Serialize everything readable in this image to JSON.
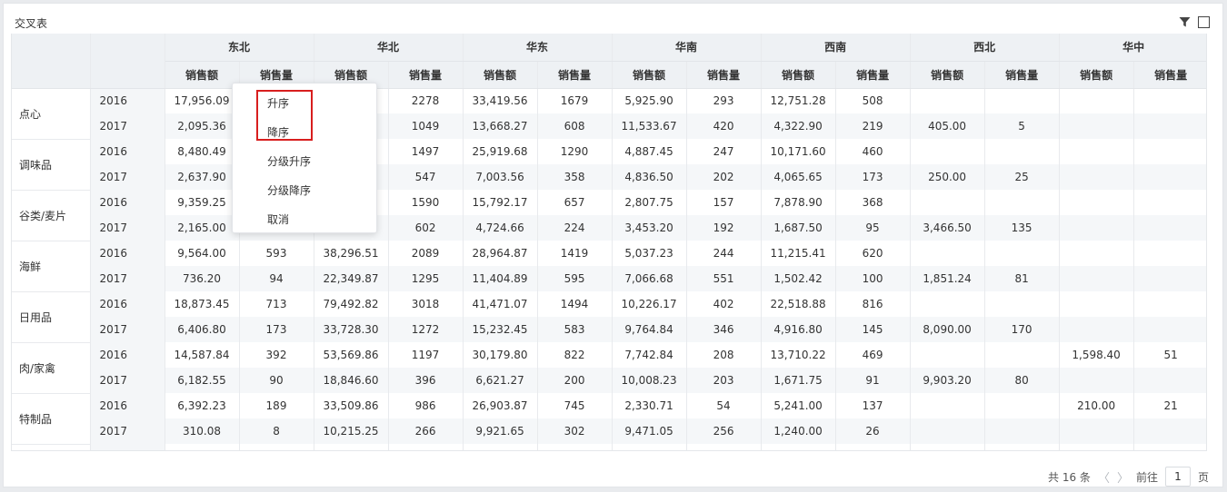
{
  "widget": {
    "title": "交叉表"
  },
  "table": {
    "regions": [
      "东北",
      "华北",
      "华东",
      "华南",
      "西南",
      "西北",
      "华中"
    ],
    "metrics": [
      "销售额",
      "销售量"
    ],
    "groups": [
      {
        "category": "点心",
        "rows": [
          {
            "year": "2016",
            "cells": [
              "17,956.09",
              "",
              "",
              "2278",
              "33,419.56",
              "1679",
              "5,925.90",
              "293",
              "12,751.28",
              "508",
              "",
              "",
              "",
              ""
            ]
          },
          {
            "year": "2017",
            "cells": [
              "2,095.36",
              "",
              "",
              "1049",
              "13,668.27",
              "608",
              "11,533.67",
              "420",
              "4,322.90",
              "219",
              "405.00",
              "5",
              "",
              ""
            ]
          }
        ]
      },
      {
        "category": "调味品",
        "rows": [
          {
            "year": "2016",
            "cells": [
              "8,480.49",
              "",
              "",
              "1497",
              "25,919.68",
              "1290",
              "4,887.45",
              "247",
              "10,171.60",
              "460",
              "",
              "",
              "",
              ""
            ]
          },
          {
            "year": "2017",
            "cells": [
              "2,637.90",
              "",
              "",
              "547",
              "7,003.56",
              "358",
              "4,836.50",
              "202",
              "4,065.65",
              "173",
              "250.00",
              "25",
              "",
              ""
            ]
          }
        ]
      },
      {
        "category": "谷类/麦片",
        "rows": [
          {
            "year": "2016",
            "cells": [
              "9,359.25",
              "",
              "",
              "1590",
              "15,792.17",
              "657",
              "2,807.75",
              "157",
              "7,878.90",
              "368",
              "",
              "",
              "",
              ""
            ]
          },
          {
            "year": "2017",
            "cells": [
              "2,165.00",
              "",
              "",
              "602",
              "4,724.66",
              "224",
              "3,453.20",
              "192",
              "1,687.50",
              "95",
              "3,466.50",
              "135",
              "",
              ""
            ]
          }
        ]
      },
      {
        "category": "海鲜",
        "rows": [
          {
            "year": "2016",
            "cells": [
              "9,564.00",
              "593",
              "38,296.51",
              "2089",
              "28,964.87",
              "1419",
              "5,037.23",
              "244",
              "11,215.41",
              "620",
              "",
              "",
              "",
              ""
            ]
          },
          {
            "year": "2017",
            "cells": [
              "736.20",
              "94",
              "22,349.87",
              "1295",
              "11,404.89",
              "595",
              "7,066.68",
              "551",
              "1,502.42",
              "100",
              "1,851.24",
              "81",
              "",
              ""
            ]
          }
        ]
      },
      {
        "category": "日用品",
        "rows": [
          {
            "year": "2016",
            "cells": [
              "18,873.45",
              "713",
              "79,492.82",
              "3018",
              "41,471.07",
              "1494",
              "10,226.17",
              "402",
              "22,518.88",
              "816",
              "",
              "",
              "",
              ""
            ]
          },
          {
            "year": "2017",
            "cells": [
              "6,406.80",
              "173",
              "33,728.30",
              "1272",
              "15,232.45",
              "583",
              "9,764.84",
              "346",
              "4,916.80",
              "145",
              "8,090.00",
              "170",
              "",
              ""
            ]
          }
        ]
      },
      {
        "category": "肉/家禽",
        "rows": [
          {
            "year": "2016",
            "cells": [
              "14,587.84",
              "392",
              "53,569.86",
              "1197",
              "30,179.80",
              "822",
              "7,742.84",
              "208",
              "13,710.22",
              "469",
              "",
              "",
              "1,598.40",
              "51"
            ]
          },
          {
            "year": "2017",
            "cells": [
              "6,182.55",
              "90",
              "18,846.60",
              "396",
              "6,621.27",
              "200",
              "10,008.23",
              "203",
              "1,671.75",
              "91",
              "9,903.20",
              "80",
              "",
              ""
            ]
          }
        ]
      },
      {
        "category": "特制品",
        "rows": [
          {
            "year": "2016",
            "cells": [
              "6,392.23",
              "189",
              "33,509.86",
              "986",
              "26,903.87",
              "745",
              "2,330.71",
              "54",
              "5,241.00",
              "137",
              "",
              "",
              "210.00",
              "21"
            ]
          },
          {
            "year": "2017",
            "cells": [
              "310.08",
              "8",
              "10,215.25",
              "266",
              "9,921.65",
              "302",
              "9,471.05",
              "256",
              "1,240.00",
              "26",
              "",
              "",
              "",
              ""
            ]
          }
        ]
      }
    ]
  },
  "context_menu": {
    "items": [
      "升序",
      "降序",
      "分级升序",
      "分级降序",
      "取消"
    ],
    "highlight_color": "#d81e1e"
  },
  "pager": {
    "total": "共 16 条",
    "goto_prefix": "前往",
    "page": "1",
    "goto_suffix": "页"
  },
  "icons": {
    "filter": "filter-icon",
    "maximize": "maximize-icon"
  }
}
